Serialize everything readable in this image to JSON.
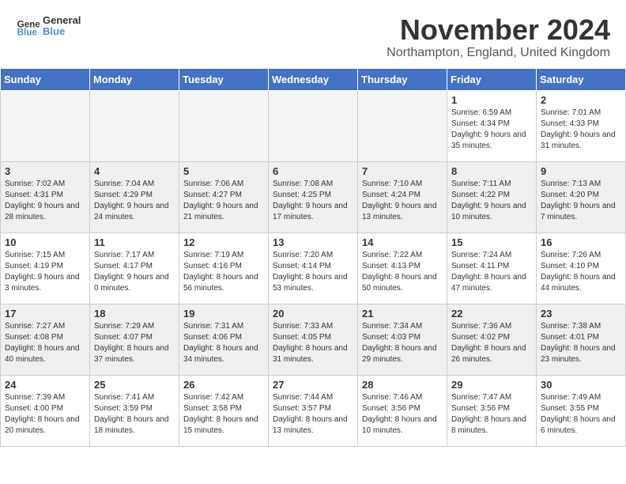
{
  "header": {
    "logo_line1": "General",
    "logo_line2": "Blue",
    "month_title": "November 2024",
    "location": "Northampton, England, United Kingdom"
  },
  "weekdays": [
    "Sunday",
    "Monday",
    "Tuesday",
    "Wednesday",
    "Thursday",
    "Friday",
    "Saturday"
  ],
  "weeks": [
    [
      {
        "day": "",
        "info": ""
      },
      {
        "day": "",
        "info": ""
      },
      {
        "day": "",
        "info": ""
      },
      {
        "day": "",
        "info": ""
      },
      {
        "day": "",
        "info": ""
      },
      {
        "day": "1",
        "info": "Sunrise: 6:59 AM\nSunset: 4:34 PM\nDaylight: 9 hours and 35 minutes."
      },
      {
        "day": "2",
        "info": "Sunrise: 7:01 AM\nSunset: 4:33 PM\nDaylight: 9 hours and 31 minutes."
      }
    ],
    [
      {
        "day": "3",
        "info": "Sunrise: 7:02 AM\nSunset: 4:31 PM\nDaylight: 9 hours and 28 minutes."
      },
      {
        "day": "4",
        "info": "Sunrise: 7:04 AM\nSunset: 4:29 PM\nDaylight: 9 hours and 24 minutes."
      },
      {
        "day": "5",
        "info": "Sunrise: 7:06 AM\nSunset: 4:27 PM\nDaylight: 9 hours and 21 minutes."
      },
      {
        "day": "6",
        "info": "Sunrise: 7:08 AM\nSunset: 4:25 PM\nDaylight: 9 hours and 17 minutes."
      },
      {
        "day": "7",
        "info": "Sunrise: 7:10 AM\nSunset: 4:24 PM\nDaylight: 9 hours and 13 minutes."
      },
      {
        "day": "8",
        "info": "Sunrise: 7:11 AM\nSunset: 4:22 PM\nDaylight: 9 hours and 10 minutes."
      },
      {
        "day": "9",
        "info": "Sunrise: 7:13 AM\nSunset: 4:20 PM\nDaylight: 9 hours and 7 minutes."
      }
    ],
    [
      {
        "day": "10",
        "info": "Sunrise: 7:15 AM\nSunset: 4:19 PM\nDaylight: 9 hours and 3 minutes."
      },
      {
        "day": "11",
        "info": "Sunrise: 7:17 AM\nSunset: 4:17 PM\nDaylight: 9 hours and 0 minutes."
      },
      {
        "day": "12",
        "info": "Sunrise: 7:19 AM\nSunset: 4:16 PM\nDaylight: 8 hours and 56 minutes."
      },
      {
        "day": "13",
        "info": "Sunrise: 7:20 AM\nSunset: 4:14 PM\nDaylight: 8 hours and 53 minutes."
      },
      {
        "day": "14",
        "info": "Sunrise: 7:22 AM\nSunset: 4:13 PM\nDaylight: 8 hours and 50 minutes."
      },
      {
        "day": "15",
        "info": "Sunrise: 7:24 AM\nSunset: 4:11 PM\nDaylight: 8 hours and 47 minutes."
      },
      {
        "day": "16",
        "info": "Sunrise: 7:26 AM\nSunset: 4:10 PM\nDaylight: 8 hours and 44 minutes."
      }
    ],
    [
      {
        "day": "17",
        "info": "Sunrise: 7:27 AM\nSunset: 4:08 PM\nDaylight: 8 hours and 40 minutes."
      },
      {
        "day": "18",
        "info": "Sunrise: 7:29 AM\nSunset: 4:07 PM\nDaylight: 8 hours and 37 minutes."
      },
      {
        "day": "19",
        "info": "Sunrise: 7:31 AM\nSunset: 4:06 PM\nDaylight: 8 hours and 34 minutes."
      },
      {
        "day": "20",
        "info": "Sunrise: 7:33 AM\nSunset: 4:05 PM\nDaylight: 8 hours and 31 minutes."
      },
      {
        "day": "21",
        "info": "Sunrise: 7:34 AM\nSunset: 4:03 PM\nDaylight: 8 hours and 29 minutes."
      },
      {
        "day": "22",
        "info": "Sunrise: 7:36 AM\nSunset: 4:02 PM\nDaylight: 8 hours and 26 minutes."
      },
      {
        "day": "23",
        "info": "Sunrise: 7:38 AM\nSunset: 4:01 PM\nDaylight: 8 hours and 23 minutes."
      }
    ],
    [
      {
        "day": "24",
        "info": "Sunrise: 7:39 AM\nSunset: 4:00 PM\nDaylight: 8 hours and 20 minutes."
      },
      {
        "day": "25",
        "info": "Sunrise: 7:41 AM\nSunset: 3:59 PM\nDaylight: 8 hours and 18 minutes."
      },
      {
        "day": "26",
        "info": "Sunrise: 7:42 AM\nSunset: 3:58 PM\nDaylight: 8 hours and 15 minutes."
      },
      {
        "day": "27",
        "info": "Sunrise: 7:44 AM\nSunset: 3:57 PM\nDaylight: 8 hours and 13 minutes."
      },
      {
        "day": "28",
        "info": "Sunrise: 7:46 AM\nSunset: 3:56 PM\nDaylight: 8 hours and 10 minutes."
      },
      {
        "day": "29",
        "info": "Sunrise: 7:47 AM\nSunset: 3:56 PM\nDaylight: 8 hours and 8 minutes."
      },
      {
        "day": "30",
        "info": "Sunrise: 7:49 AM\nSunset: 3:55 PM\nDaylight: 8 hours and 6 minutes."
      }
    ]
  ]
}
